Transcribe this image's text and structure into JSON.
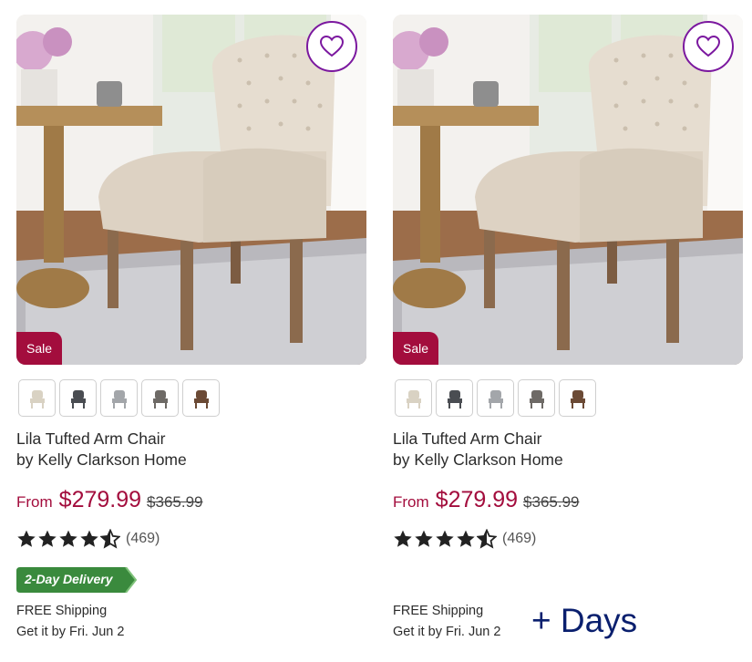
{
  "colors": {
    "brand_purple": "#7b189f",
    "sale_red": "#a30d3d",
    "delivery_green": "#3a8a3d",
    "days_navy": "#0a1f6e"
  },
  "products": [
    {
      "sale_label": "Sale",
      "swatches": [
        "cream",
        "charcoal",
        "light-gray",
        "dark-gray",
        "brown"
      ],
      "title_line1": "Lila Tufted Arm Chair",
      "title_line2": "by Kelly Clarkson Home",
      "price_prefix": "From",
      "price": "$279.99",
      "original_price": "$365.99",
      "rating": 4.5,
      "review_count": "(469)",
      "delivery_badge": "2-Day Delivery",
      "shipping": "FREE Shipping",
      "delivery_date": "Get it by Fri. Jun 2"
    },
    {
      "sale_label": "Sale",
      "swatches": [
        "cream",
        "charcoal",
        "light-gray",
        "dark-gray",
        "brown"
      ],
      "title_line1": "Lila Tufted Arm Chair",
      "title_line2": "by Kelly Clarkson Home",
      "price_prefix": "From",
      "price": "$279.99",
      "original_price": "$365.99",
      "rating": 4.5,
      "review_count": "(469)",
      "shipping": "FREE Shipping",
      "delivery_date": "Get it by Fri. Jun 2"
    }
  ],
  "overlay_text": "+ Days"
}
